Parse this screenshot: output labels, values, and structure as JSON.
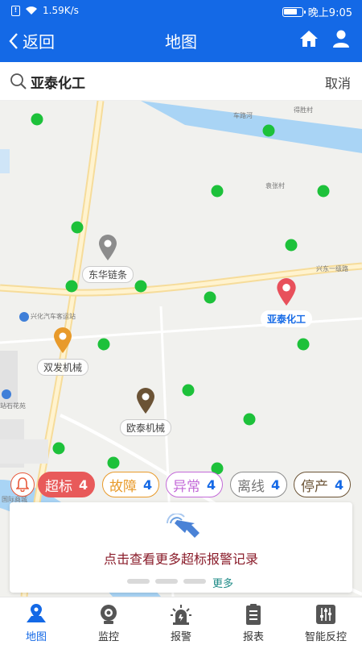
{
  "status_bar": {
    "speed": "1.59K/s",
    "time": "晚上9:05",
    "battery_level": 0.75
  },
  "header": {
    "back_label": "返回",
    "title": "地图"
  },
  "search": {
    "value": "亚泰化工",
    "cancel_label": "取消"
  },
  "map": {
    "road_labels": {
      "river": "车路河",
      "village_1": "得胜村",
      "village_2": "袁张村",
      "road_east": "兴东一级路",
      "station": "兴化汽车客运站",
      "plaza": "站石花苑",
      "mall": "国际商城"
    },
    "pins": [
      {
        "label": "东华链条",
        "color": "#8c8c8c",
        "selected": false
      },
      {
        "label": "亚泰化工",
        "color": "#e8505b",
        "selected": true
      },
      {
        "label": "双发机械",
        "color": "#e89a2a",
        "selected": false
      },
      {
        "label": "欧泰机械",
        "color": "#6b5335",
        "selected": false
      }
    ]
  },
  "chips": [
    {
      "label": "超标",
      "count": "4",
      "style": "filled"
    },
    {
      "label": "故障",
      "count": "4",
      "color": "#e89a2a"
    },
    {
      "label": "异常",
      "count": "4",
      "color": "#c36ad8"
    },
    {
      "label": "离线",
      "count": "4",
      "color": "#8c8c8c"
    },
    {
      "label": "停产",
      "count": "4",
      "color": "#6b5335"
    }
  ],
  "card": {
    "text": "点击查看更多超标报警记录",
    "more_label": "更多"
  },
  "tabs": [
    {
      "label": "地图",
      "icon": "map-pin-icon",
      "active": true
    },
    {
      "label": "监控",
      "icon": "camera-icon",
      "active": false
    },
    {
      "label": "报警",
      "icon": "alarm-icon",
      "active": false
    },
    {
      "label": "报表",
      "icon": "clipboard-icon",
      "active": false
    },
    {
      "label": "智能反控",
      "icon": "sliders-icon",
      "active": false
    }
  ]
}
